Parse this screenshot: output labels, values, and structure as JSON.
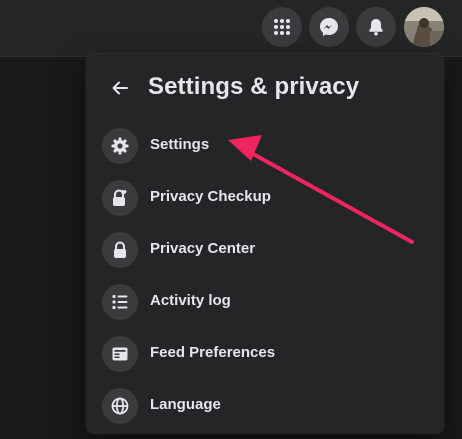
{
  "topbar": {
    "menu_icon": "grid-menu-icon",
    "messenger_icon": "messenger-icon",
    "notifications_icon": "bell-icon",
    "avatar": "profile-avatar"
  },
  "panel": {
    "title": "Settings & privacy",
    "back_icon": "arrow-left-icon",
    "items": [
      {
        "label": "Settings",
        "icon": "gear-icon"
      },
      {
        "label": "Privacy Checkup",
        "icon": "lock-heart-icon"
      },
      {
        "label": "Privacy Center",
        "icon": "lock-icon"
      },
      {
        "label": "Activity log",
        "icon": "list-icon"
      },
      {
        "label": "Feed Preferences",
        "icon": "feed-icon"
      },
      {
        "label": "Language",
        "icon": "globe-icon"
      }
    ]
  },
  "annotation": {
    "color": "#f0245f",
    "target": "Settings"
  },
  "colors": {
    "background": "#18191a",
    "surface": "#242526",
    "icon_bg": "#3a3b3c",
    "text": "#e4e6eb"
  }
}
